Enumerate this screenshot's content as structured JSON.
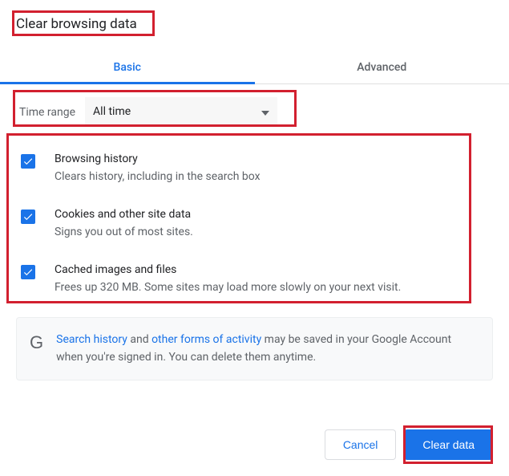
{
  "title": "Clear browsing data",
  "tabs": {
    "basic": "Basic",
    "advanced": "Advanced"
  },
  "timeRange": {
    "label": "Time range",
    "value": "All time"
  },
  "options": [
    {
      "title": "Browsing history",
      "desc": "Clears history, including in the search box"
    },
    {
      "title": "Cookies and other site data",
      "desc": "Signs you out of most sites."
    },
    {
      "title": "Cached images and files",
      "desc": "Frees up 320 MB. Some sites may load more slowly on your next visit."
    }
  ],
  "notice": {
    "link1": "Search history",
    "mid1": " and ",
    "link2": "other forms of activity",
    "rest": " may be saved in your Google Account when you're signed in. You can delete them anytime."
  },
  "buttons": {
    "cancel": "Cancel",
    "clear": "Clear data"
  }
}
